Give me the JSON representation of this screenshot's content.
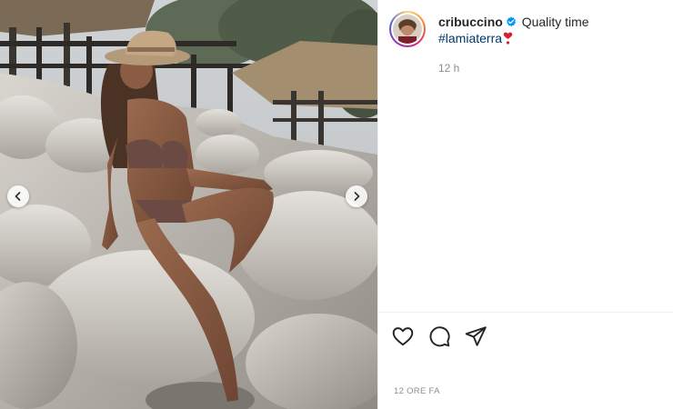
{
  "post": {
    "username": "cribuccino",
    "caption_text": "Quality time",
    "hashtag": "#lamiaterra",
    "posted_ago": "12 h",
    "posted_date_label": "12 ORE FA"
  },
  "media": {
    "description_icon": "photo",
    "prev_icon": "chevron-left-icon",
    "next_icon": "chevron-right-icon"
  },
  "actions": {
    "like_icon": "heart-icon",
    "comment_icon": "comment-icon",
    "share_icon": "share-icon"
  },
  "colors": {
    "verified_blue": "#0095f6",
    "hashtag_blue": "#00376b",
    "muted_text": "#8e8e8e",
    "heart_red": "#d8202f"
  }
}
